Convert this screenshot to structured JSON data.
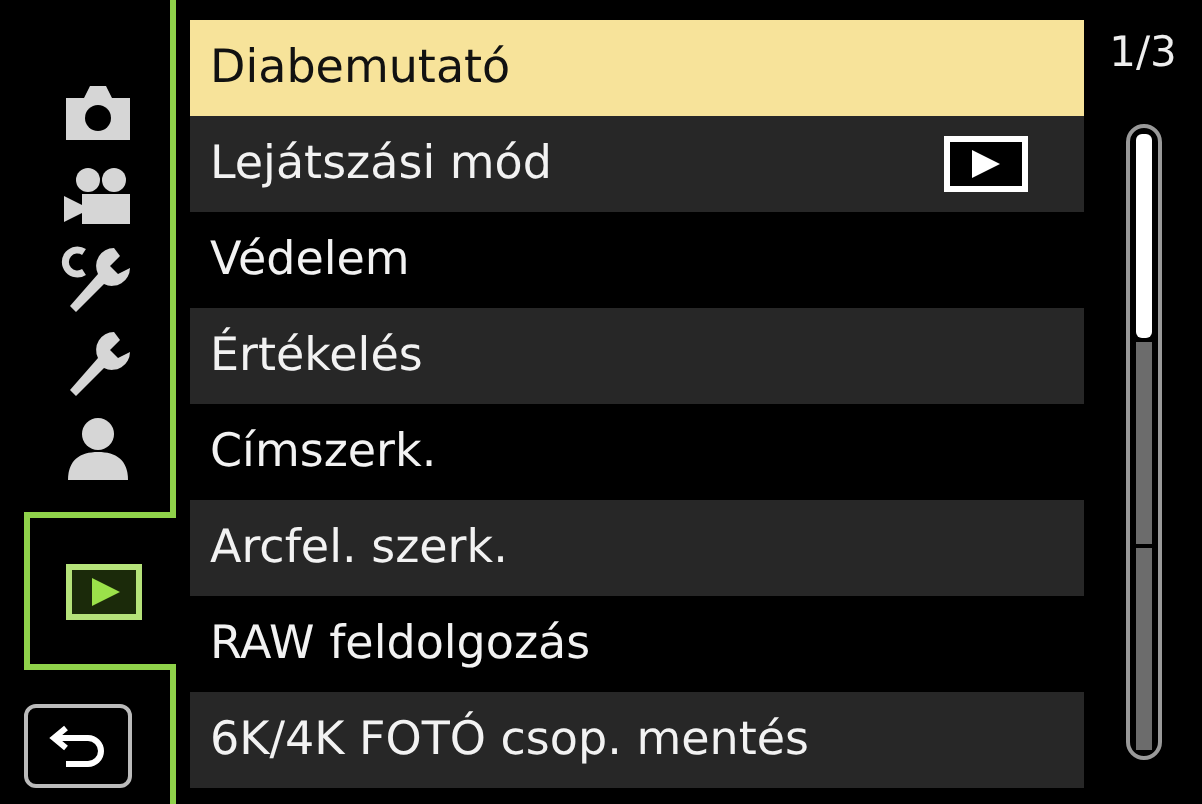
{
  "sidebar": {
    "tabs": [
      {
        "kind": "camera",
        "selected": false
      },
      {
        "kind": "video",
        "selected": false
      },
      {
        "kind": "custom",
        "selected": false
      },
      {
        "kind": "setup",
        "selected": false
      },
      {
        "kind": "mymenu",
        "selected": false
      },
      {
        "kind": "playback",
        "selected": true
      }
    ]
  },
  "menu": {
    "items": [
      {
        "label": "Diabemutató",
        "selected": true,
        "kind": "plain"
      },
      {
        "label": "Lejátszási mód",
        "selected": false,
        "kind": "play"
      },
      {
        "label": "Védelem",
        "selected": false,
        "kind": "plain"
      },
      {
        "label": "Értékelés",
        "selected": false,
        "kind": "plain"
      },
      {
        "label": "Címszerk.",
        "selected": false,
        "kind": "plain"
      },
      {
        "label": "Arcfel. szerk.",
        "selected": false,
        "kind": "plain"
      },
      {
        "label": "RAW feldolgozás",
        "selected": false,
        "kind": "plain"
      },
      {
        "label": "6K/4K FOTÓ csop. mentés",
        "selected": false,
        "kind": "plain"
      }
    ]
  },
  "page_indicator": "1/3"
}
